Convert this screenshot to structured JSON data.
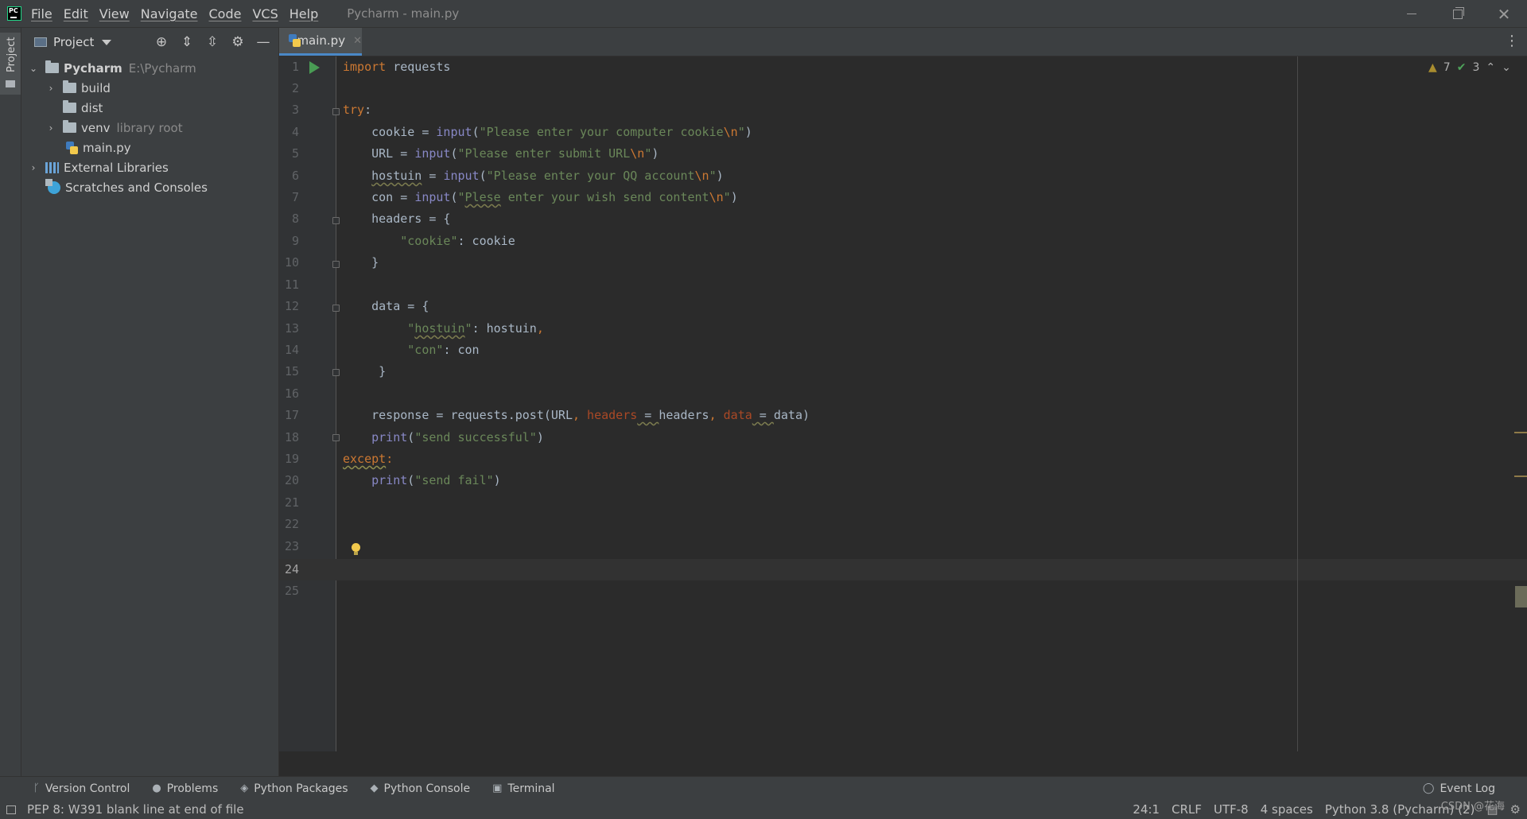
{
  "menu": {
    "items": [
      "File",
      "Edit",
      "View",
      "Navigate",
      "Code",
      "VCS",
      "Help"
    ],
    "window_title": "Pycharm - main.py"
  },
  "tool_strip": {
    "project_label": "Project"
  },
  "project_panel": {
    "title": "Project",
    "tree": {
      "root_name": "Pycharm",
      "root_path": "E:\\Pycharm",
      "build": "build",
      "dist": "dist",
      "venv": "venv",
      "venv_note": "library root",
      "main_file": "main.py",
      "external_libraries": "External Libraries",
      "scratches": "Scratches and Consoles"
    }
  },
  "editor": {
    "tab_label": "main.py",
    "line_numbers": [
      "1",
      "2",
      "3",
      "4",
      "5",
      "6",
      "7",
      "8",
      "9",
      "10",
      "11",
      "12",
      "13",
      "14",
      "15",
      "16",
      "17",
      "18",
      "19",
      "20",
      "21",
      "22",
      "23",
      "24",
      "25"
    ],
    "current_line": "24",
    "inspections": {
      "warnings": "7",
      "weak_warnings": "3"
    },
    "code": {
      "l1_kw": "import",
      "l1_rest": " requests",
      "l3_kw": "try",
      "l3_rest": ":",
      "l4_a": "    cookie = ",
      "l4_fn": "input",
      "l4_s1": "\"Please enter your computer cookie",
      "l4_esc": "\\n",
      "l4_s2": "\"",
      "l5_a": "    URL = ",
      "l5_fn": "input",
      "l5_s1": "\"Please enter submit URL",
      "l5_esc": "\\n",
      "l5_s2": "\"",
      "l6_var": "hostuin",
      "l6_a": " = ",
      "l6_fn": "input",
      "l6_s1": "\"Please enter your QQ account",
      "l6_esc": "\\n",
      "l6_s2": "\"",
      "l7_a": "    con = ",
      "l7_fn": "input",
      "l7_s0": "\"",
      "l7_typo": "Plese",
      "l7_s1": " enter your wish send content",
      "l7_esc": "\\n",
      "l7_s2": "\"",
      "l8": "    headers = {",
      "l9_str": "\"cookie\"",
      "l9_rest": ": cookie",
      "l10": "    }",
      "l12": "    data = {",
      "l13_q1": "\"",
      "l13_key": "hostuin",
      "l13_q2": "\"",
      "l13_rest": ": hostuin",
      "l13_comma": ",",
      "l14_str": "\"con\"",
      "l14_rest": ": con",
      "l15": "     }",
      "l17_a": "    response = requests.post(URL",
      "l17_c1": ", ",
      "l17_p1": "headers",
      "l17_eq1": " = ",
      "l17_v1": "headers",
      "l17_c2": ", ",
      "l17_p2": "data",
      "l17_eq2": " = ",
      "l17_v2": "data)",
      "l18_a": "    ",
      "l18_fn": "print",
      "l18_s": "\"send successful\"",
      "l19_kw": "except",
      "l19_rest": ":",
      "l20_a": "    ",
      "l20_fn": "print",
      "l20_s": "\"send fail\""
    }
  },
  "tool_windows": [
    "Version Control",
    "Problems",
    "Python Packages",
    "Python Console",
    "Terminal",
    "Event Log"
  ],
  "status": {
    "message": "PEP 8: W391 blank line at end of file",
    "position": "24:1",
    "line_sep": "CRLF",
    "encoding": "UTF-8",
    "indent": "4 spaces",
    "interpreter": "Python 3.8 (Pycharm) (2)",
    "watermark": "CSDN @花海"
  }
}
